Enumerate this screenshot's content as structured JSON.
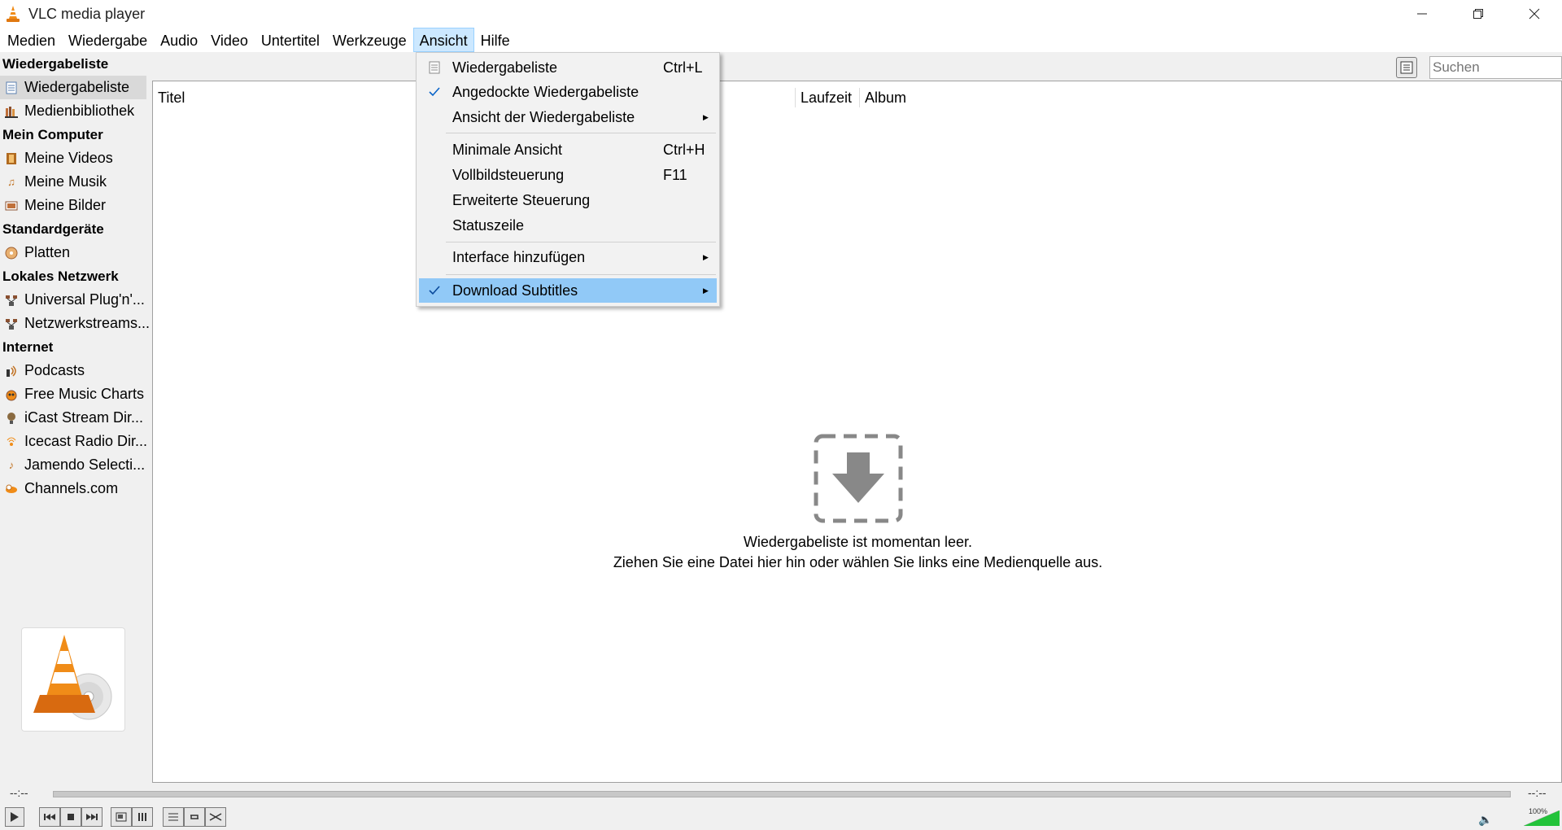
{
  "window": {
    "title": "VLC media player",
    "controls": [
      "minimize-icon",
      "restore-icon",
      "close-icon"
    ]
  },
  "menubar": {
    "items": [
      "Medien",
      "Wiedergabe",
      "Audio",
      "Video",
      "Untertitel",
      "Werkzeuge",
      "Ansicht",
      "Hilfe"
    ],
    "active": "Ansicht"
  },
  "sidebar": {
    "sections": [
      {
        "header": "Wiedergabeliste",
        "items": [
          {
            "label": "Wiedergabeliste",
            "icon": "playlist-icon",
            "selected": true
          },
          {
            "label": "Medienbibliothek",
            "icon": "library-icon"
          }
        ]
      },
      {
        "header": "Mein Computer",
        "items": [
          {
            "label": "Meine Videos",
            "icon": "film-icon"
          },
          {
            "label": "Meine Musik",
            "icon": "music-note-icon"
          },
          {
            "label": "Meine Bilder",
            "icon": "picture-icon"
          }
        ]
      },
      {
        "header": "Standardgeräte",
        "items": [
          {
            "label": "Platten",
            "icon": "disc-icon"
          }
        ]
      },
      {
        "header": "Lokales Netzwerk",
        "items": [
          {
            "label": "Universal Plug'n'...",
            "icon": "network-icon"
          },
          {
            "label": "Netzwerkstreams...",
            "icon": "network-icon"
          }
        ]
      },
      {
        "header": "Internet",
        "items": [
          {
            "label": "Podcasts",
            "icon": "podcast-icon"
          },
          {
            "label": "Free Music Charts",
            "icon": "charts-icon"
          },
          {
            "label": "iCast Stream Dir...",
            "icon": "icast-icon"
          },
          {
            "label": "Icecast Radio Dir...",
            "icon": "radio-icon"
          },
          {
            "label": "Jamendo Selecti...",
            "icon": "jamendo-icon"
          },
          {
            "label": "Channels.com",
            "icon": "channels-icon"
          }
        ]
      }
    ]
  },
  "search": {
    "placeholder": "Suchen"
  },
  "playlist": {
    "columns": [
      "Titel",
      "Laufzeit",
      "Album"
    ],
    "empty_line1": "Wiedergabeliste ist momentan leer.",
    "empty_line2": "Ziehen Sie eine Datei hier hin oder wählen Sie links eine Medienquelle aus."
  },
  "view_menu": {
    "items": [
      {
        "label": "Wiedergabeliste",
        "shortcut": "Ctrl+L",
        "icon": "playlist-icon"
      },
      {
        "label": "Angedockte Wiedergabeliste",
        "checked": true
      },
      {
        "label": "Ansicht der Wiedergabeliste",
        "submenu": true
      },
      {
        "label": "Minimale Ansicht",
        "shortcut": "Ctrl+H"
      },
      {
        "label": "Vollbildsteuerung",
        "shortcut": "F11"
      },
      {
        "label": "Erweiterte Steuerung"
      },
      {
        "label": "Statuszeile"
      },
      {
        "label": "Interface hinzufügen",
        "submenu": true
      },
      {
        "label": "Download Subtitles",
        "checked": true,
        "submenu": true,
        "highlighted": true
      }
    ]
  },
  "playback": {
    "elapsed": "--:--",
    "remaining": "--:--",
    "volume": "100%",
    "volume_level": 1.0
  },
  "colors": {
    "menu_highlight": "#91c9f7",
    "menubar_active": "#cce8ff",
    "volume_green": "#22c33a",
    "vlc_orange": "#f08c18"
  }
}
